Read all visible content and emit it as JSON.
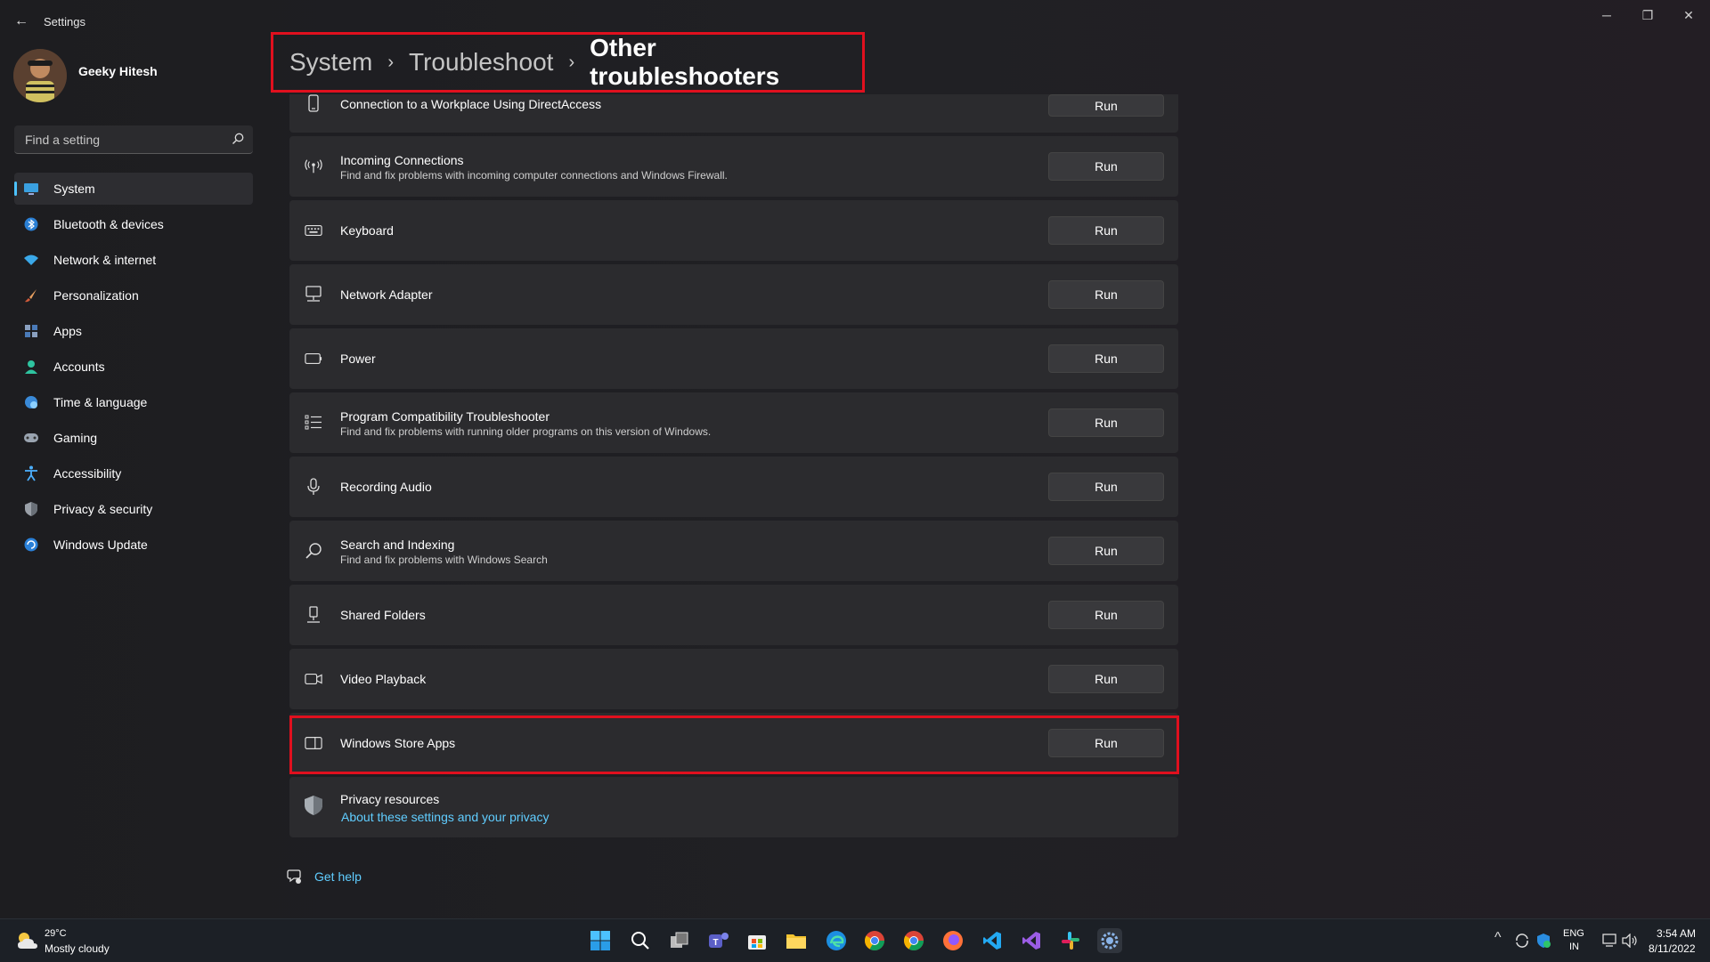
{
  "window": {
    "title": "Settings",
    "back_glyph": "←",
    "min_glyph": "─",
    "max_glyph": "❐",
    "close_glyph": "✕"
  },
  "profile": {
    "name": "Geeky Hitesh"
  },
  "search": {
    "placeholder": "Find a setting"
  },
  "nav": {
    "items": [
      {
        "label": "System",
        "icon": "monitor-icon",
        "active": true
      },
      {
        "label": "Bluetooth & devices",
        "icon": "bluetooth-icon"
      },
      {
        "label": "Network & internet",
        "icon": "wifi-icon"
      },
      {
        "label": "Personalization",
        "icon": "brush-icon"
      },
      {
        "label": "Apps",
        "icon": "apps-icon"
      },
      {
        "label": "Accounts",
        "icon": "person-icon"
      },
      {
        "label": "Time & language",
        "icon": "globe-clock-icon"
      },
      {
        "label": "Gaming",
        "icon": "controller-icon"
      },
      {
        "label": "Accessibility",
        "icon": "accessibility-icon"
      },
      {
        "label": "Privacy & security",
        "icon": "shield-icon"
      },
      {
        "label": "Windows Update",
        "icon": "update-icon"
      }
    ]
  },
  "breadcrumb": {
    "level1": "System",
    "level2": "Troubleshoot",
    "current": "Other troubleshooters",
    "sep": "›"
  },
  "troubleshooters": [
    {
      "title": "Connection to a Workplace Using DirectAccess",
      "subtitle": "",
      "icon": "phone-icon",
      "button": "Run"
    },
    {
      "title": "Incoming Connections",
      "subtitle": "Find and fix problems with incoming computer connections and Windows Firewall.",
      "icon": "antenna-icon",
      "button": "Run"
    },
    {
      "title": "Keyboard",
      "subtitle": "",
      "icon": "keyboard-icon",
      "button": "Run"
    },
    {
      "title": "Network Adapter",
      "subtitle": "",
      "icon": "network-adapter-icon",
      "button": "Run"
    },
    {
      "title": "Power",
      "subtitle": "",
      "icon": "battery-icon",
      "button": "Run"
    },
    {
      "title": "Program Compatibility Troubleshooter",
      "subtitle": "Find and fix problems with running older programs on this version of Windows.",
      "icon": "list-icon",
      "button": "Run"
    },
    {
      "title": "Recording Audio",
      "subtitle": "",
      "icon": "microphone-icon",
      "button": "Run"
    },
    {
      "title": "Search and Indexing",
      "subtitle": "Find and fix problems with Windows Search",
      "icon": "search-icon",
      "button": "Run"
    },
    {
      "title": "Shared Folders",
      "subtitle": "",
      "icon": "shared-folder-icon",
      "button": "Run"
    },
    {
      "title": "Video Playback",
      "subtitle": "",
      "icon": "video-camera-icon",
      "button": "Run"
    },
    {
      "title": "Windows Store Apps",
      "subtitle": "",
      "icon": "store-apps-icon",
      "button": "Run"
    }
  ],
  "privacy": {
    "title": "Privacy resources",
    "link": "About these settings and your privacy"
  },
  "help": {
    "label": "Get help"
  },
  "taskbar": {
    "weather": {
      "temp": "29°C",
      "condition": "Mostly cloudy"
    },
    "lang": {
      "line1": "ENG",
      "line2": "IN"
    },
    "clock": {
      "time": "3:54 AM",
      "date": "8/11/2022"
    },
    "tray_chevron": "^"
  },
  "colors": {
    "accent": "#4cc2ff",
    "highlight": "#e0101e",
    "link": "#60cdff"
  }
}
